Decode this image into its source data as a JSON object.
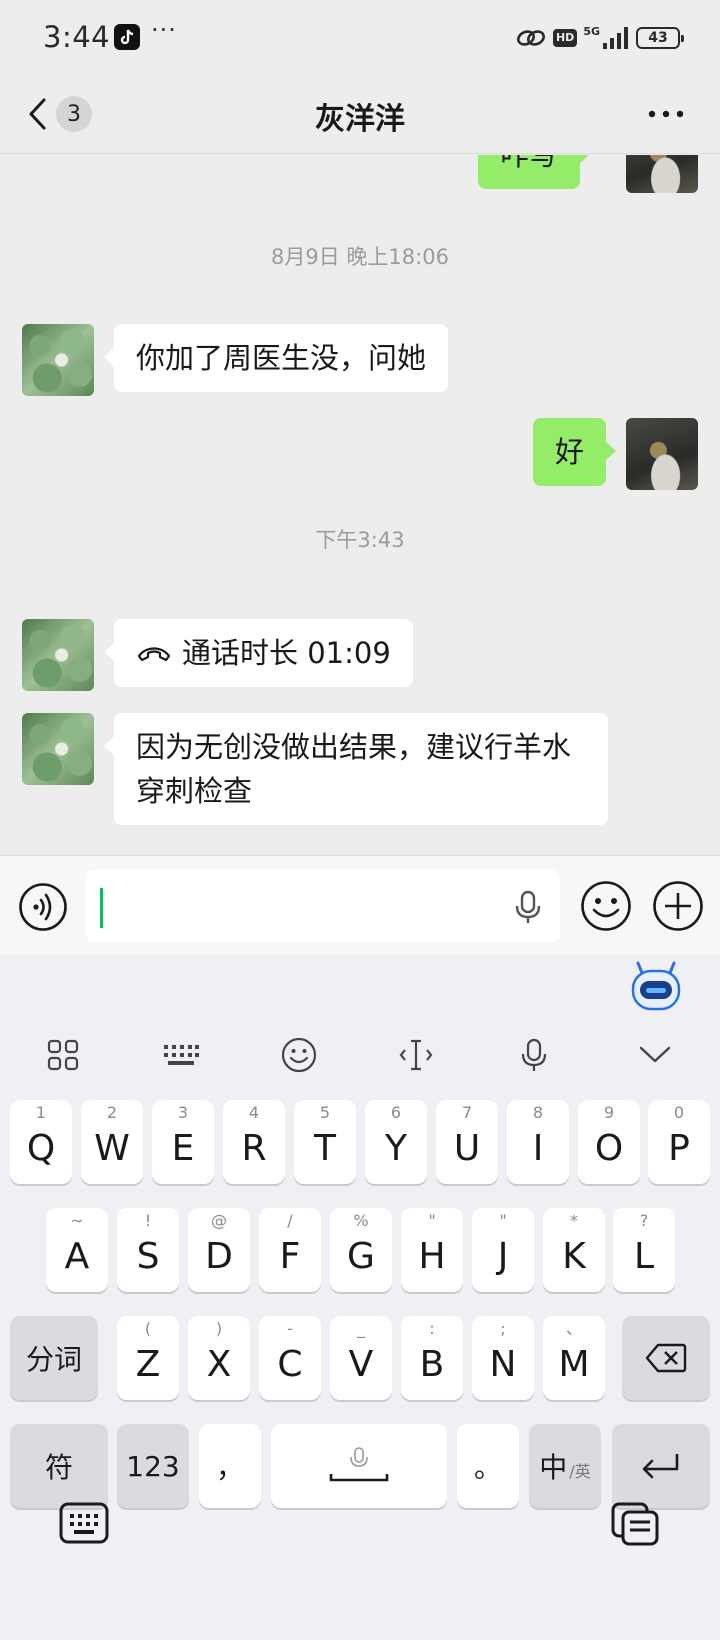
{
  "status_bar": {
    "time": "3:44",
    "more": "···",
    "hd": "HD",
    "network": "5G",
    "battery": "43"
  },
  "header": {
    "unread_count": "3",
    "title": "灰洋洋"
  },
  "messages": {
    "partial_sent": "咋写",
    "timestamp_1": "8月9日 晚上18:06",
    "received_1": "你加了周医生没，问她",
    "sent_1": "好",
    "timestamp_2": "下午3:43",
    "call_label": "通话时长 01:09",
    "received_2": "因为无创没做出结果，建议行羊水穿刺检查"
  },
  "input": {
    "value": ""
  },
  "keyboard": {
    "row1": [
      {
        "hint": "1",
        "key": "Q"
      },
      {
        "hint": "2",
        "key": "W"
      },
      {
        "hint": "3",
        "key": "E"
      },
      {
        "hint": "4",
        "key": "R"
      },
      {
        "hint": "5",
        "key": "T"
      },
      {
        "hint": "6",
        "key": "Y"
      },
      {
        "hint": "7",
        "key": "U"
      },
      {
        "hint": "8",
        "key": "I"
      },
      {
        "hint": "9",
        "key": "O"
      },
      {
        "hint": "0",
        "key": "P"
      }
    ],
    "row2": [
      {
        "hint": "~",
        "key": "A"
      },
      {
        "hint": "!",
        "key": "S"
      },
      {
        "hint": "@",
        "key": "D"
      },
      {
        "hint": "/",
        "key": "F"
      },
      {
        "hint": "%",
        "key": "G"
      },
      {
        "hint": "\"",
        "key": "H"
      },
      {
        "hint": "\"",
        "key": "J"
      },
      {
        "hint": "*",
        "key": "K"
      },
      {
        "hint": "?",
        "key": "L"
      }
    ],
    "row3": [
      {
        "hint": "(",
        "key": "Z"
      },
      {
        "hint": ")",
        "key": "X"
      },
      {
        "hint": "-",
        "key": "C"
      },
      {
        "hint": "_",
        "key": "V"
      },
      {
        "hint": ":",
        "key": "B"
      },
      {
        "hint": ";",
        "key": "N"
      },
      {
        "hint": "、",
        "key": "M"
      }
    ],
    "segment_key": "分词",
    "symbol_key": "符",
    "numeric_key": "123",
    "comma_key": "，",
    "period_key": "。",
    "lang_key": "中",
    "lang_sub": "/英"
  }
}
